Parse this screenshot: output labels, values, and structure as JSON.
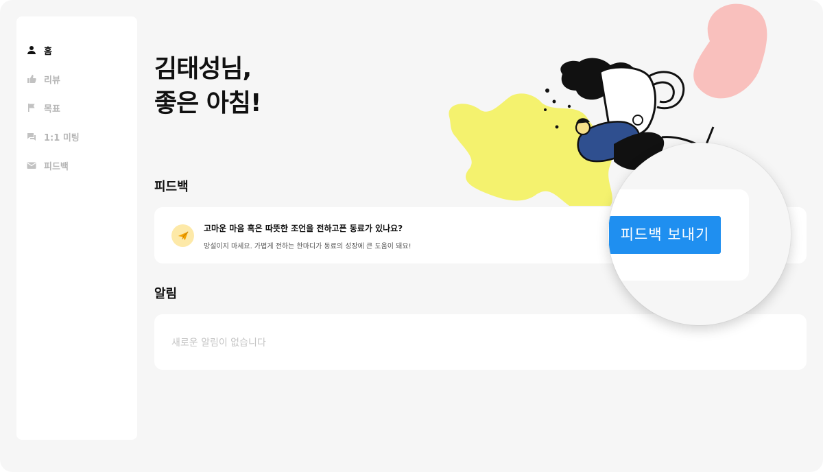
{
  "sidebar": {
    "items": [
      {
        "label": "홈",
        "icon": "person-icon",
        "active": true
      },
      {
        "label": "리뷰",
        "icon": "thumbs-up-icon",
        "active": false
      },
      {
        "label": "목표",
        "icon": "flag-icon",
        "active": false
      },
      {
        "label": "1:1 미팅",
        "icon": "chat-icon",
        "active": false
      },
      {
        "label": "피드백",
        "icon": "mail-icon",
        "active": false
      }
    ]
  },
  "greeting": {
    "line1": "김태성님,",
    "line2": "좋은 아침!"
  },
  "feedback": {
    "section_title": "피드백",
    "card_title": "고마운 마음 혹은 따뜻한 조언을 전하고픈 동료가 있나요?",
    "card_subtitle": "망설이지 마세요. 가볍게 전하는 한마디가 동료의 성장에 큰 도움이 돼요!",
    "button_label": "피드백 보내기"
  },
  "notifications": {
    "section_title": "알림",
    "empty_text": "새로운 알림이 없습니다"
  },
  "colors": {
    "accent": "#1f8ff0",
    "background": "#f6f6f6",
    "inactive_nav": "#b5b5b5",
    "illustration_yellow": "#f4f26e",
    "illustration_pink": "#f9c0bd"
  }
}
